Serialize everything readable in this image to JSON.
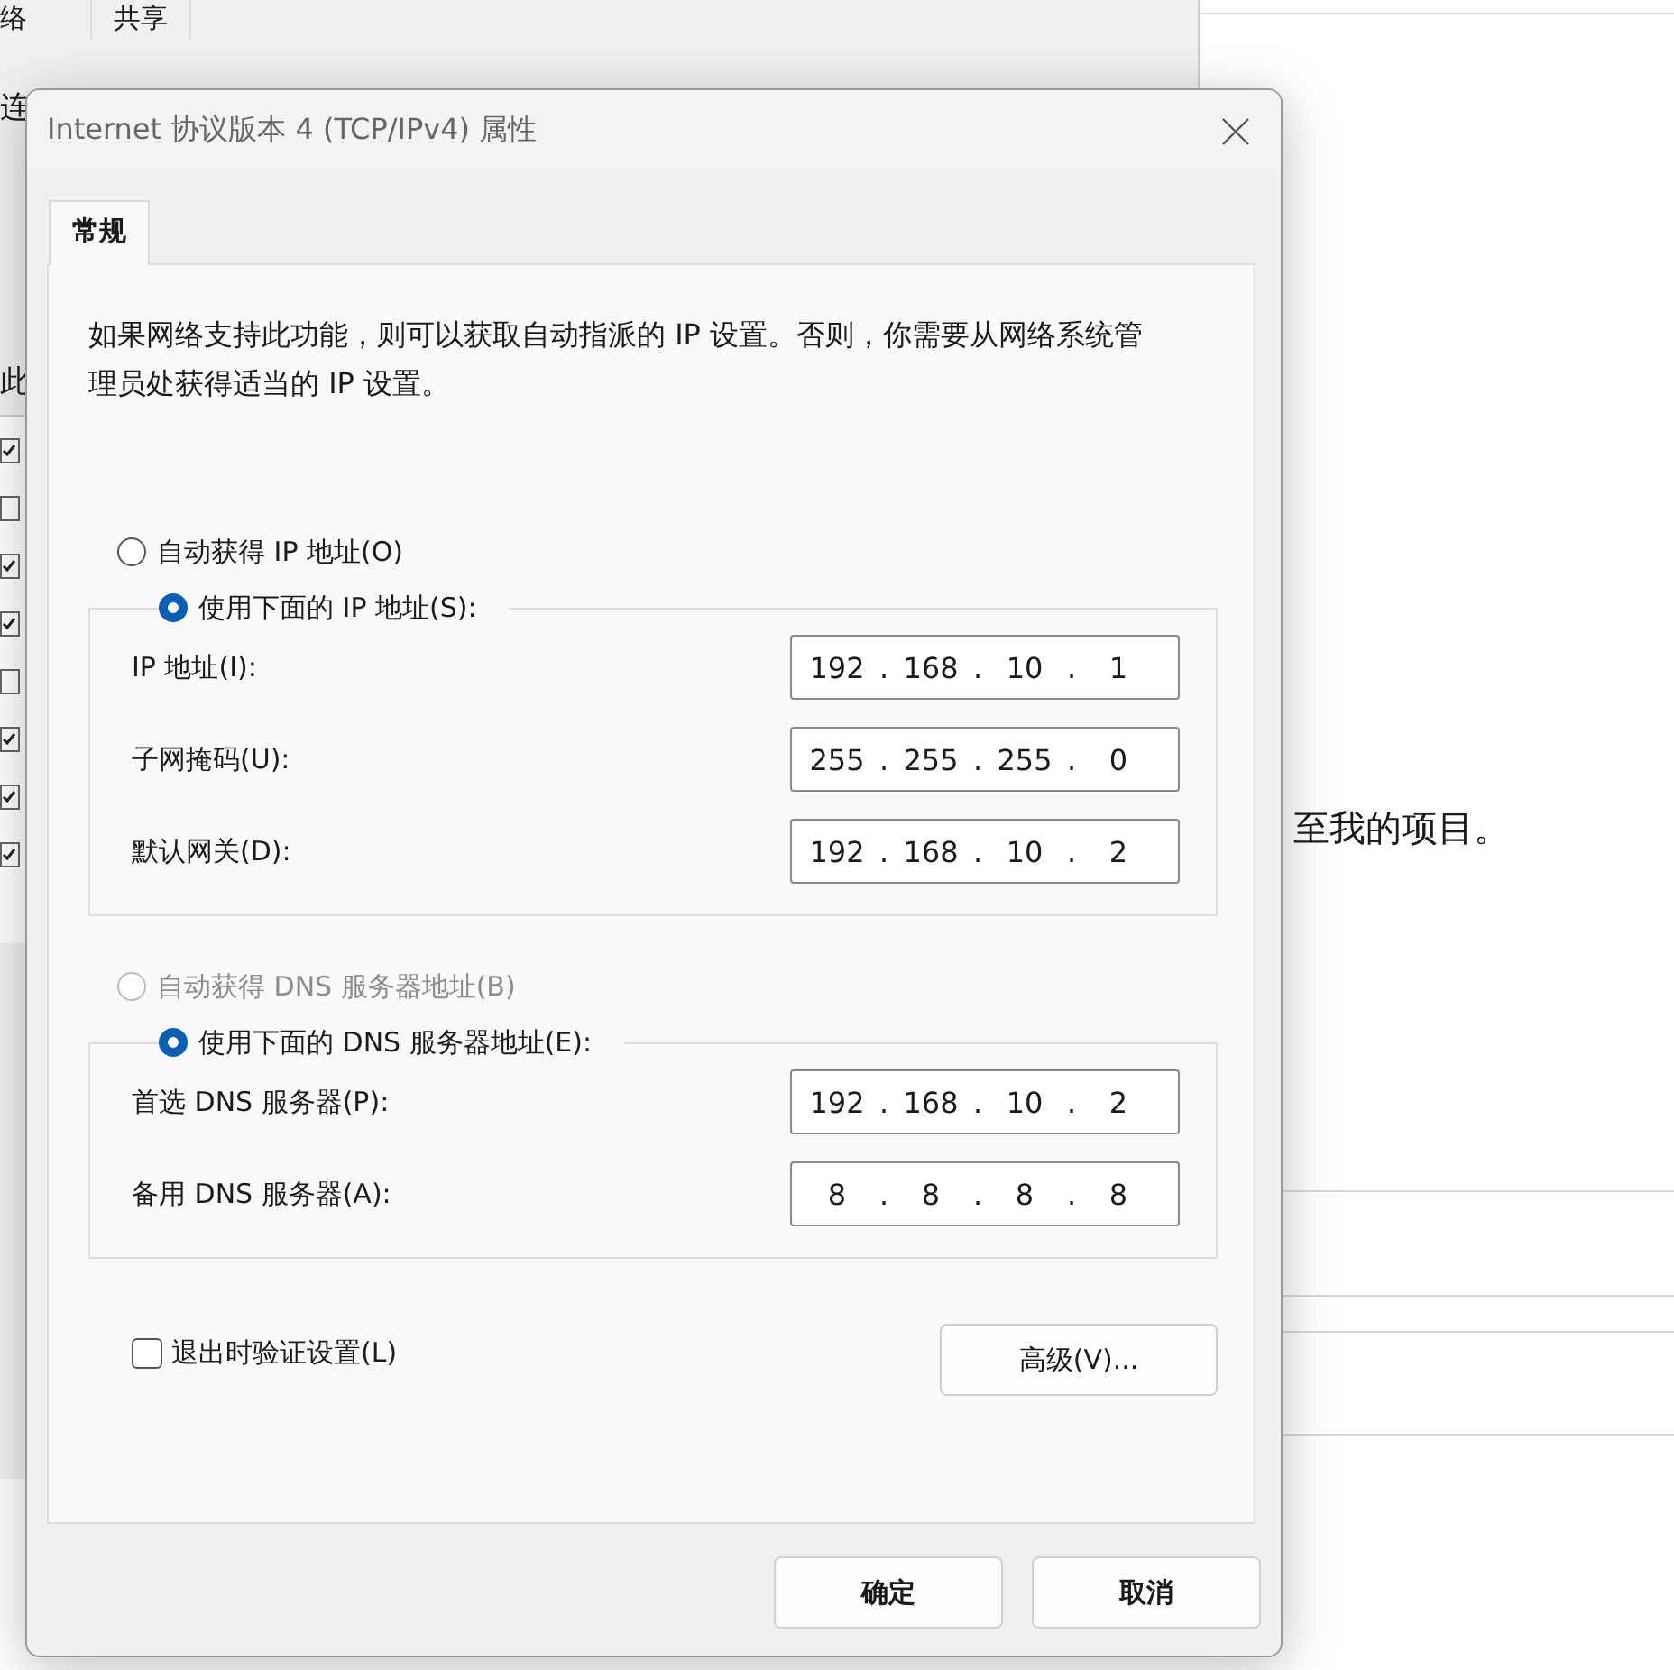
{
  "background_window": {
    "tabs": [
      {
        "label": "络"
      },
      {
        "label": "共享"
      }
    ],
    "labels": [
      "连",
      "此"
    ],
    "checkboxes": [
      {
        "checked": true
      },
      {
        "checked": false
      },
      {
        "checked": true
      },
      {
        "checked": true
      },
      {
        "checked": false
      },
      {
        "checked": true
      },
      {
        "checked": true
      },
      {
        "checked": true
      }
    ]
  },
  "background_page": {
    "text": "至我的项目。"
  },
  "dialog": {
    "title": "Internet 协议版本 4 (TCP/IPv4) 属性",
    "tabs": [
      {
        "label": "常规",
        "selected": true
      }
    ],
    "description": "如果网络支持此功能，则可以获取自动指派的 IP 设置。否则，你需要从网络系统管理员处获得适当的 IP 设置。",
    "separator": ".",
    "sections": [
      {
        "auto_option": {
          "label": "自动获得 IP 地址(O)",
          "selected": false,
          "disabled": false
        },
        "manual_option": {
          "label": "使用下面的 IP 地址(S):",
          "selected": true,
          "disabled": false
        },
        "fields": [
          {
            "label": "IP 地址(I):",
            "octets": [
              "192",
              "168",
              "10",
              "1"
            ]
          },
          {
            "label": "子网掩码(U):",
            "octets": [
              "255",
              "255",
              "255",
              "0"
            ]
          },
          {
            "label": "默认网关(D):",
            "octets": [
              "192",
              "168",
              "10",
              "2"
            ]
          }
        ]
      },
      {
        "auto_option": {
          "label": "自动获得 DNS 服务器地址(B)",
          "selected": false,
          "disabled": true
        },
        "manual_option": {
          "label": "使用下面的 DNS 服务器地址(E):",
          "selected": true,
          "disabled": false
        },
        "fields": [
          {
            "label": "首选 DNS 服务器(P):",
            "octets": [
              "192",
              "168",
              "10",
              "2"
            ]
          },
          {
            "label": "备用 DNS 服务器(A):",
            "octets": [
              "8",
              "8",
              "8",
              "8"
            ]
          }
        ]
      }
    ],
    "validate_checkbox": {
      "label": "退出时验证设置(L)",
      "checked": false
    },
    "advanced_button": "高级(V)...",
    "buttons": [
      "确定",
      "取消"
    ]
  }
}
